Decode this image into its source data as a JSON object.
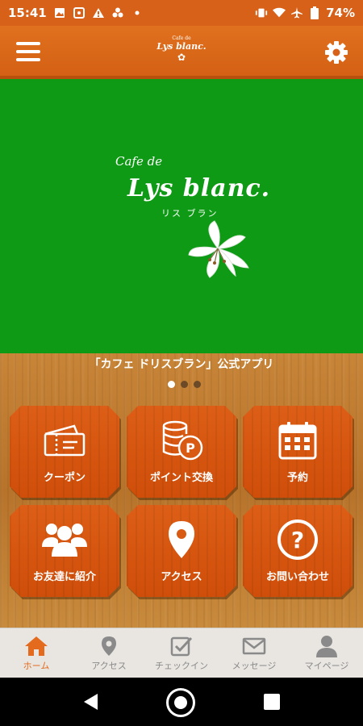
{
  "status_bar": {
    "time": "15:41",
    "battery": "74%",
    "icons_left": [
      "gallery-icon",
      "sync-icon",
      "warning-icon",
      "fan-icon",
      "dot-icon"
    ],
    "icons_right": [
      "vibrate-icon",
      "wifi-icon",
      "airplane-icon",
      "battery-icon"
    ]
  },
  "header": {
    "logo_small": "Cafe de",
    "logo_text": "Lys blanc."
  },
  "banner": {
    "cafe_de": "Cafe de",
    "brand": "Lys blanc.",
    "kana": "リス ブラン",
    "background_color": "#0e9a14"
  },
  "caption": "「カフェ ドリスブラン」公式アプリ",
  "carousel": {
    "dots": 3,
    "active_index": 0
  },
  "tiles": [
    {
      "label": "クーポン",
      "icon": "ticket-icon"
    },
    {
      "label": "ポイント交換",
      "icon": "coins-icon"
    },
    {
      "label": "予約",
      "icon": "calendar-icon"
    },
    {
      "label": "お友達に紹介",
      "icon": "people-icon"
    },
    {
      "label": "アクセス",
      "icon": "map-pin-icon"
    },
    {
      "label": "お問い合わせ",
      "icon": "question-icon"
    }
  ],
  "bottom_nav": [
    {
      "label": "ホーム",
      "icon": "home-icon",
      "active": true
    },
    {
      "label": "アクセス",
      "icon": "map-pin-icon",
      "active": false
    },
    {
      "label": "チェックイン",
      "icon": "checkbox-icon",
      "active": false
    },
    {
      "label": "メッセージ",
      "icon": "mail-icon",
      "active": false
    },
    {
      "label": "マイページ",
      "icon": "person-icon",
      "active": false
    }
  ],
  "colors": {
    "accent": "#e46b1e",
    "tile": "#d95a12",
    "banner_green": "#0e9a14"
  }
}
